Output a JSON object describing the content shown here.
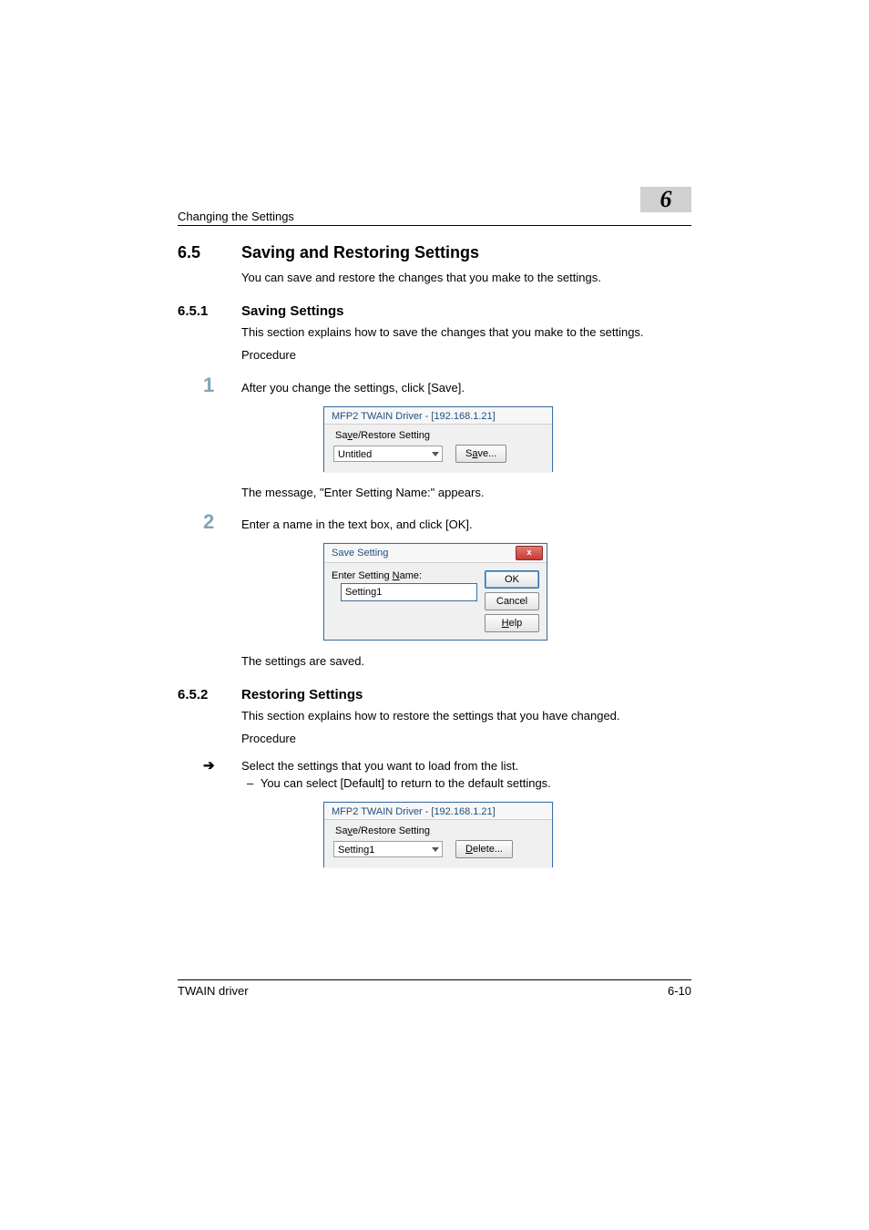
{
  "header": {
    "running_head": "Changing the Settings",
    "chapter_badge": "6"
  },
  "sec65": {
    "num": "6.5",
    "title": "Saving and Restoring Settings",
    "intro": "You can save and restore the changes that you make to the settings."
  },
  "sec651": {
    "num": "6.5.1",
    "title": "Saving Settings",
    "intro": "This section explains how to save the changes that you make to the settings.",
    "procedure_label": "Procedure",
    "step1_num": "1",
    "step1_text": "After you change the settings, click [Save].",
    "fig1": {
      "window_title": "MFP2 TWAIN Driver - [192.168.1.21]",
      "group_label_prefix": "Sa",
      "group_label_underline": "v",
      "group_label_suffix": "e/Restore Setting",
      "combo_value": "Untitled",
      "save_btn_prefix": "S",
      "save_btn_underline": "a",
      "save_btn_suffix": "ve..."
    },
    "step1_after": "The message, \"Enter Setting Name:\" appears.",
    "step2_num": "2",
    "step2_text": "Enter a name in the text box, and click [OK].",
    "fig2": {
      "window_title": "Save Setting",
      "label_prefix": "Enter Setting ",
      "label_underline": "N",
      "label_suffix": "ame:",
      "input_value": "Setting1",
      "ok_btn": "OK",
      "cancel_btn": "Cancel",
      "help_btn_underline": "H",
      "help_btn_suffix": "elp",
      "close_x": "x"
    },
    "step2_after": "The settings are saved."
  },
  "sec652": {
    "num": "6.5.2",
    "title": "Restoring Settings",
    "intro": "This section explains how to restore the settings that you have changed.",
    "procedure_label": "Procedure",
    "arrow": "➔",
    "arrow_text": "Select the settings that you want to load from the list.",
    "sub_text": "You can select [Default] to return to the default settings.",
    "fig3": {
      "window_title": "MFP2 TWAIN Driver - [192.168.1.21]",
      "group_label_prefix": "Sa",
      "group_label_underline": "v",
      "group_label_suffix": "e/Restore Setting",
      "combo_value": "Setting1",
      "delete_btn_underline": "D",
      "delete_btn_suffix": "elete..."
    }
  },
  "footer": {
    "left": "TWAIN driver",
    "right": "6-10"
  }
}
